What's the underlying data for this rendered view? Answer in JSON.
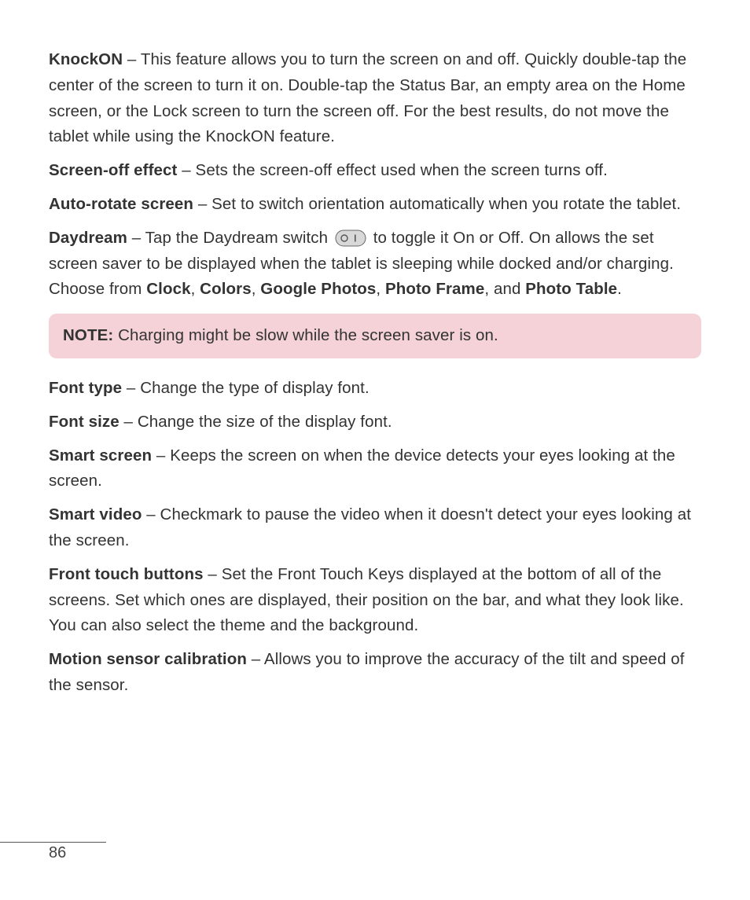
{
  "paragraphs": {
    "knockon": {
      "term": "KnockON",
      "text": " – This feature allows you to turn the screen on and off. Quickly double-tap the center of the screen to turn it on. Double-tap the Status Bar, an empty area on the Home screen, or the Lock screen to turn the screen off. For the best results, do not move the tablet while using the KnockON feature."
    },
    "screenoff": {
      "term": "Screen-off effect",
      "text": " – Sets the screen-off effect used when the screen turns off."
    },
    "autorotate": {
      "term": "Auto-rotate screen",
      "text": " – Set to switch orientation automatically when you rotate the tablet."
    },
    "daydream": {
      "term": "Daydream",
      "pre": " – Tap the Daydream switch ",
      "post1": " to toggle it On or Off. On allows the set screen saver to be displayed when the tablet is sleeping while docked and/or charging. Choose from ",
      "opt1": "Clock",
      "sep1": ", ",
      "opt2": "Colors",
      "sep2": ", ",
      "opt3": "Google Photos",
      "sep3": ", ",
      "opt4": "Photo Frame",
      "sep4": ", and ",
      "opt5": "Photo Table",
      "end": "."
    },
    "note": {
      "label": "NOTE:",
      "text": " Charging might be slow while the screen saver is on."
    },
    "fonttype": {
      "term": "Font type",
      "text": " – Change the type of display font."
    },
    "fontsize": {
      "term": "Font size",
      "text": " – Change the size of the display font."
    },
    "smartscreen": {
      "term": "Smart screen",
      "text": " – Keeps the screen on when the device detects your eyes looking at the screen."
    },
    "smartvideo": {
      "term": "Smart video",
      "text": " – Checkmark to pause the video when it doesn't detect your eyes looking at the screen."
    },
    "fronttouch": {
      "term": "Front touch buttons",
      "text": " – Set the Front Touch Keys displayed at the bottom of all of the screens. Set which ones are displayed, their position on the bar, and what they look like. You can also select the theme and the background."
    },
    "motion": {
      "term": "Motion sensor calibration",
      "text": " – Allows you to improve the accuracy of the tilt and speed of the sensor."
    }
  },
  "pageNumber": "86"
}
